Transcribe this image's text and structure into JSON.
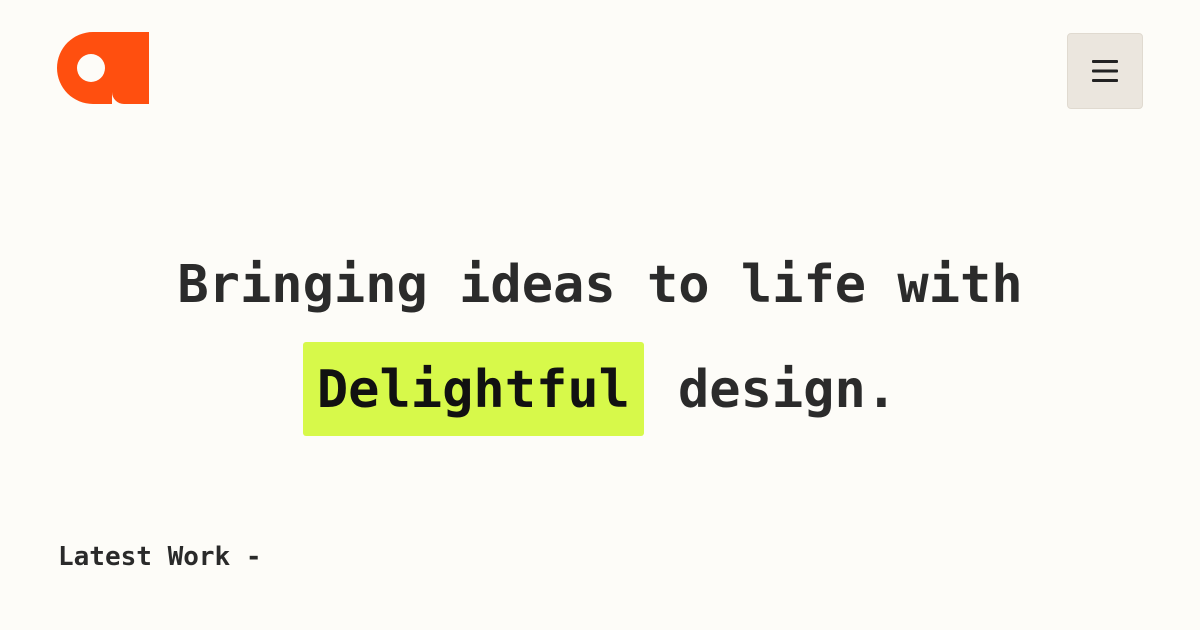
{
  "header": {
    "logo_name": "brand-logo",
    "menu_icon": "hamburger-menu-icon"
  },
  "hero": {
    "line1": "Bringing ideas to life with",
    "highlight": "Delightful",
    "line2_rest": "design."
  },
  "section": {
    "latest_work_label": "Latest Work -"
  },
  "colors": {
    "background": "#fdfcf8",
    "brand_orange": "#ff4f0f",
    "highlight_lime": "#d7f94a",
    "text": "#2a2a2a",
    "menu_button_bg": "#ebe6de"
  }
}
